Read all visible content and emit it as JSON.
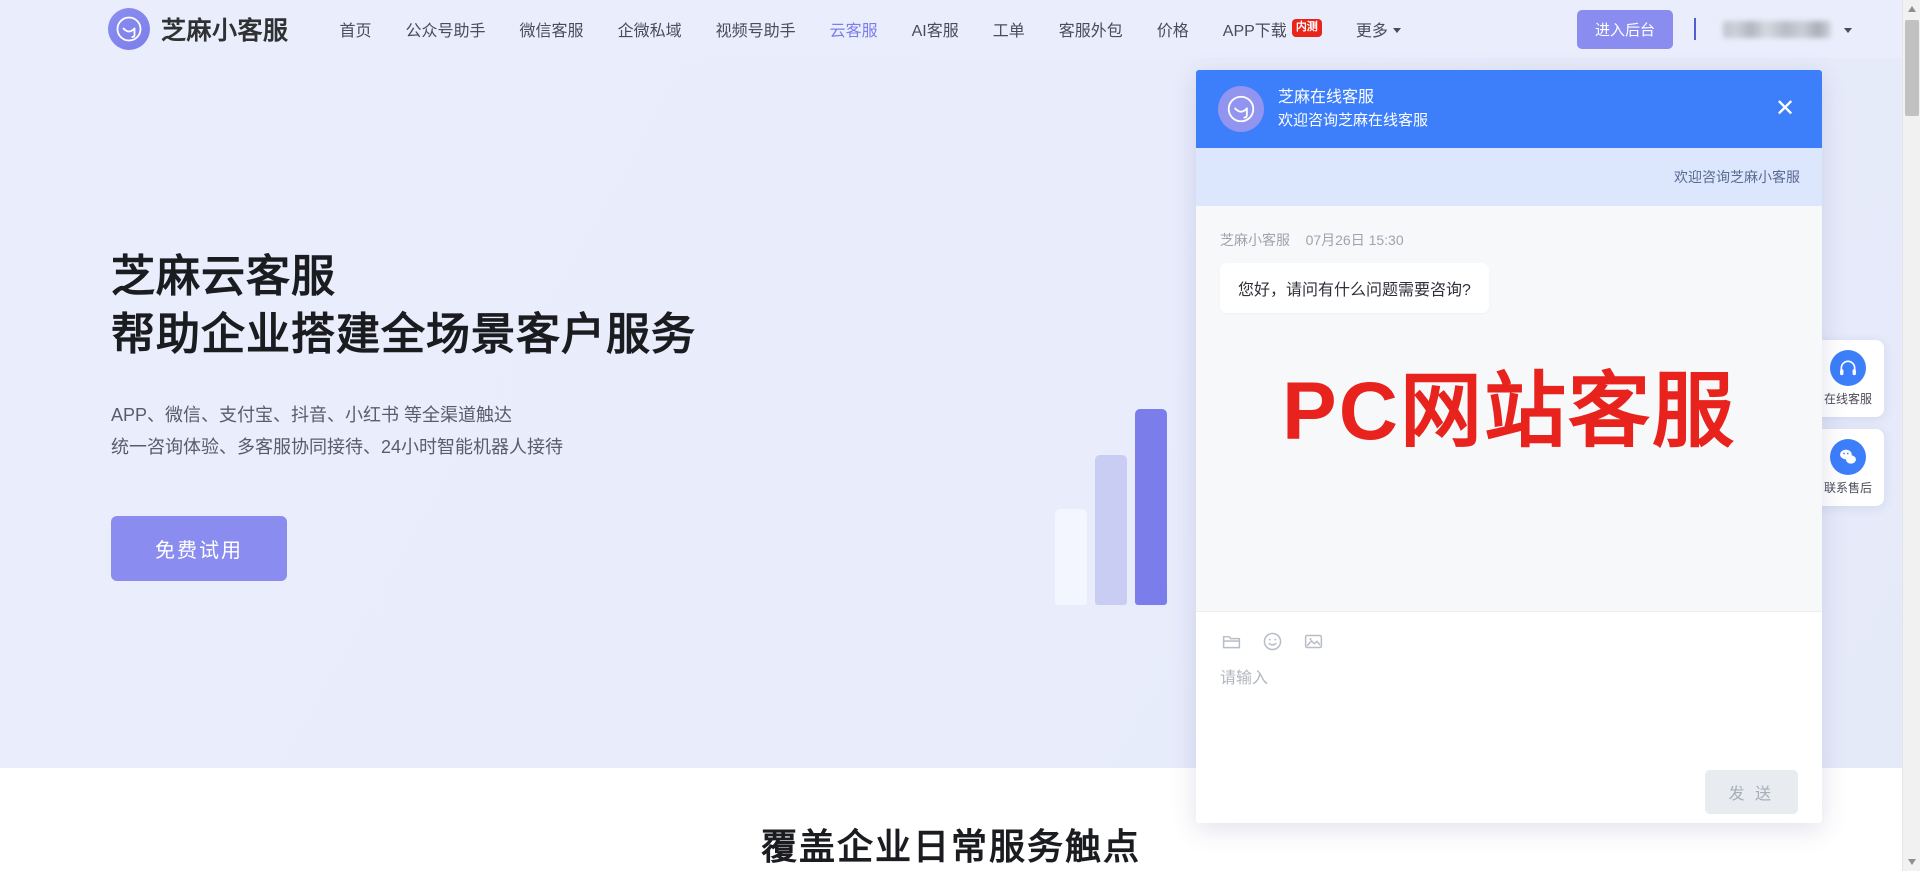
{
  "navbar": {
    "brand_name": "芝麻小客服",
    "brand_logo_icon": "smiley-circle-logo",
    "links": [
      {
        "label": "首页",
        "active": false
      },
      {
        "label": "公众号助手",
        "active": false
      },
      {
        "label": "微信客服",
        "active": false
      },
      {
        "label": "企微私域",
        "active": false
      },
      {
        "label": "视频号助手",
        "active": false
      },
      {
        "label": "云客服",
        "active": true
      },
      {
        "label": "AI客服",
        "active": false
      },
      {
        "label": "工单",
        "active": false
      },
      {
        "label": "客服外包",
        "active": false
      },
      {
        "label": "价格",
        "active": false
      }
    ],
    "app_download_label": "APP下载",
    "app_download_badge": "内测",
    "more_label": "更多",
    "console_button": "进入后台",
    "user_name_masked": ""
  },
  "hero": {
    "title_line1": "芝麻云客服",
    "title_line2": "帮助企业搭建全场景客户服务",
    "sub_line1": "APP、微信、支付宝、抖音、小红书 等全渠道触达",
    "sub_line2": "统一咨询体验、多客服协同接待、24小时智能机器人接待",
    "cta_button": "免费试用"
  },
  "section": {
    "title": "覆盖企业日常服务触点"
  },
  "float_bar": [
    {
      "label": "在线客服",
      "icon": "headset-icon"
    },
    {
      "label": "联系售后",
      "icon": "wechat-icon"
    }
  ],
  "chat": {
    "header": {
      "title": "芝麻在线客服",
      "subtitle": "欢迎咨询芝麻在线客服",
      "avatar_icon": "smiley-circle-avatar",
      "close_icon": "close-icon"
    },
    "notice": "欢迎咨询芝麻小客服",
    "messages": [
      {
        "sender": "芝麻小客服",
        "time": "07月26日 15:30",
        "text": "您好，请问有什么问题需要咨询?"
      }
    ],
    "watermark": "PC网站客服",
    "toolbar_icons": [
      {
        "name": "folder-icon"
      },
      {
        "name": "emoji-icon"
      },
      {
        "name": "image-icon"
      }
    ],
    "input_placeholder": "请输入",
    "input_value": "",
    "send_button": "发 送"
  },
  "colors": {
    "brand_purple": "#8a8def",
    "chat_blue": "#3d7efb",
    "watermark_red": "#e8221c",
    "badge_red": "#e8241b",
    "page_bg": "#eaeefc"
  }
}
